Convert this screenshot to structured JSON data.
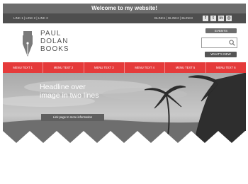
{
  "topbar": {
    "title": "Welcome to my website!"
  },
  "links": {
    "left": "LINK 1  |  LINK 2  |  LINK 3",
    "right": "BLINK1  |  BLINK2  |  BLINK3"
  },
  "social": {
    "facebook": "f",
    "twitter": "t",
    "linkedin": "in",
    "instagram": "◎"
  },
  "logo": {
    "line1": "PAUL",
    "line2": "DOLAN",
    "line3": "BOOKS"
  },
  "header": {
    "events_label": "EVENTS",
    "whats_new_label": "WHAT'S NEW"
  },
  "nav": {
    "items": [
      "MENU TEXT 1",
      "MENU TEXT 2",
      "MENU TEXT 3",
      "MENU TEXT 4",
      "MENU TEXT 5",
      "MENU TEXT 6"
    ]
  },
  "hero": {
    "headline_line1": "Headline over",
    "headline_line2": "image in two lines",
    "cta_label": "Link page to more information"
  },
  "colors": {
    "nav_red": "#e53a3a",
    "topbar": "#6d6d6d",
    "linkbar": "#4e4e4e"
  }
}
